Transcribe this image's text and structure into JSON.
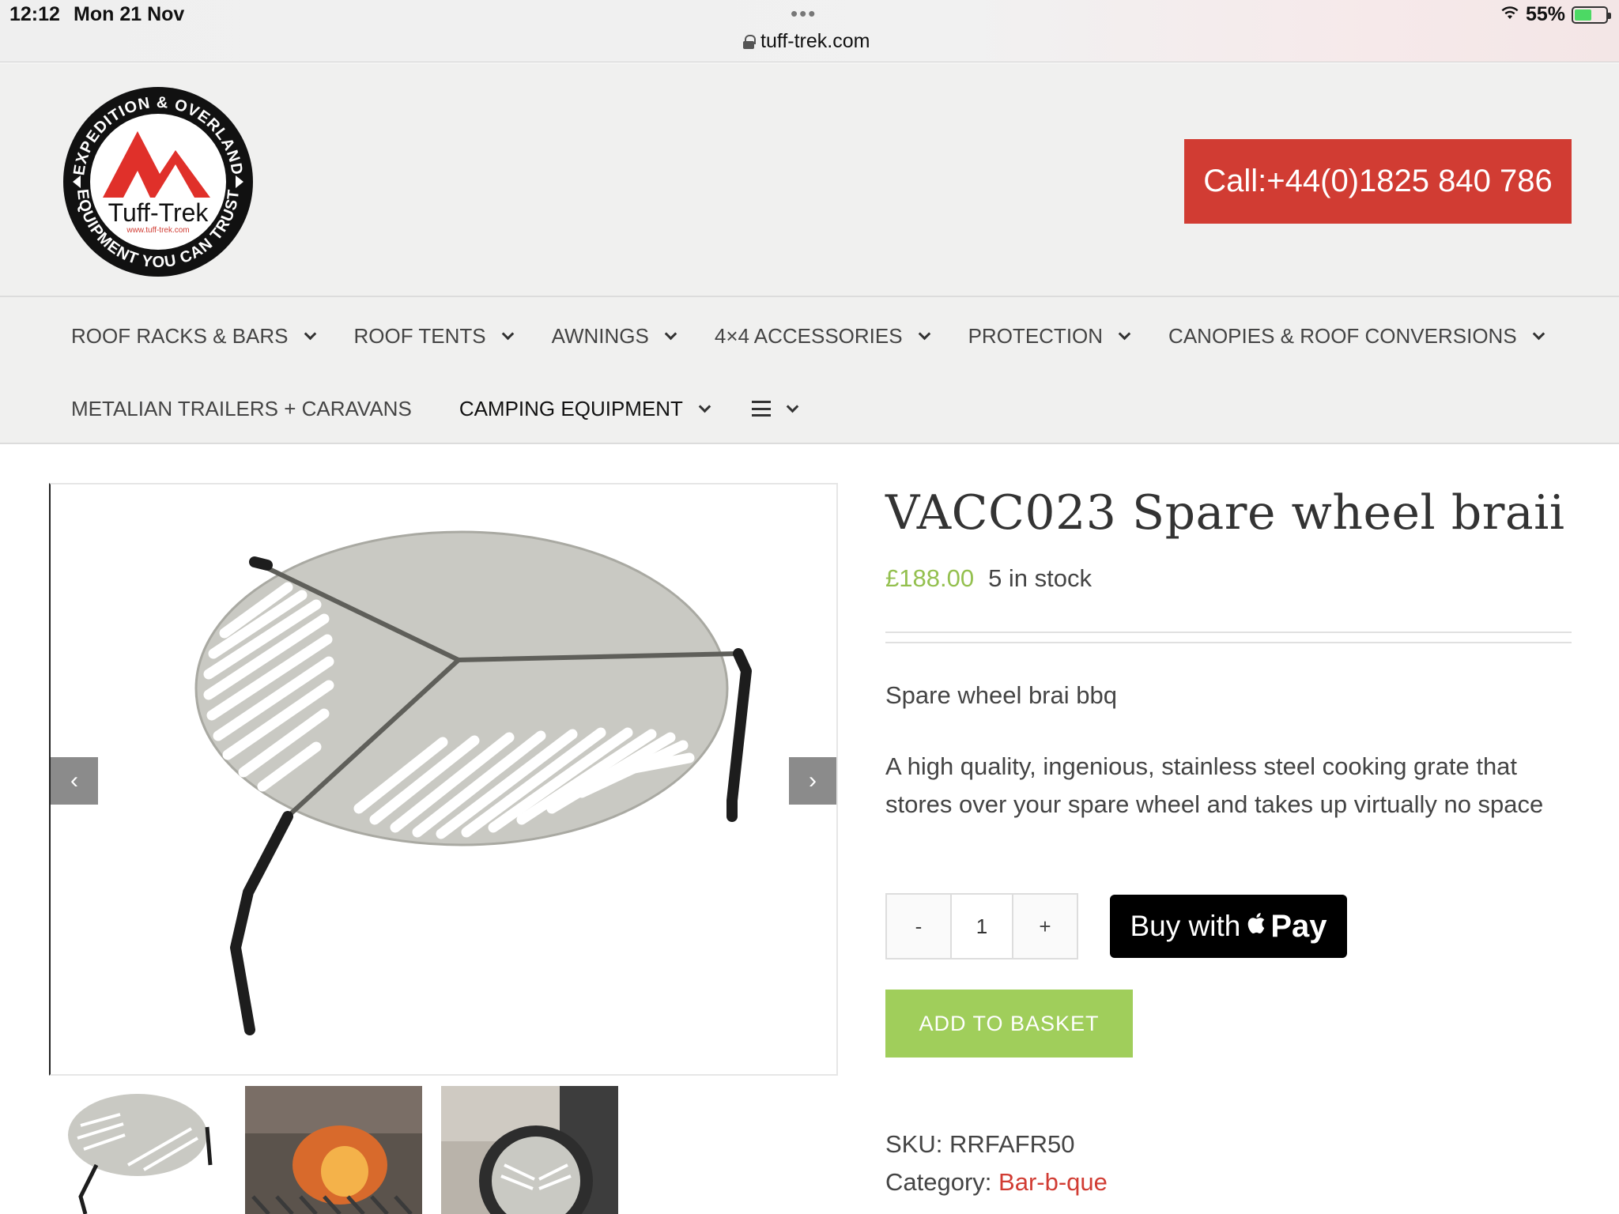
{
  "status_bar": {
    "time": "12:12",
    "date": "Mon 21 Nov",
    "url": "tuff-trek.com",
    "battery": "55%",
    "battery_level": 0.55
  },
  "header": {
    "logo_ring_top": "EXPEDITION & OVERLAND",
    "logo_ring_bottom": "EQUIPMENT YOU CAN TRUST",
    "logo_brand": "Tuff-Trek",
    "logo_url": "www.tuff-trek.com",
    "call_label": "Call:+44(0)1825 840 786",
    "brand_red": "#d13c33"
  },
  "nav": {
    "row1": [
      {
        "label": "ROOF RACKS & BARS"
      },
      {
        "label": "ROOF TENTS"
      },
      {
        "label": "AWNINGS"
      },
      {
        "label": "4×4 ACCESSORIES"
      },
      {
        "label": "PROTECTION"
      },
      {
        "label": "CANOPIES & ROOF CONVERSIONS"
      }
    ],
    "row2": [
      {
        "label": "METALIAN TRAILERS + CARAVANS"
      },
      {
        "label": "CAMPING EQUIPMENT"
      }
    ],
    "menu_icon": "hamburger-icon"
  },
  "gallery": {
    "prev_icon": "chevron-left-icon",
    "next_icon": "chevron-right-icon",
    "prev_glyph": "‹",
    "next_glyph": "›",
    "thumbnails": [
      "braai-grate",
      "braai-fire",
      "spare-wheel-mount"
    ]
  },
  "product": {
    "title": "VACC023 Spare wheel braii",
    "price": "£188.00",
    "stock": "5 in stock",
    "short_title": "Spare wheel brai bbq",
    "description": "A high quality, ingenious, stainless steel cooking grate that stores over your spare wheel and takes up virtually no space",
    "qty_minus": "-",
    "qty_value": "1",
    "qty_plus": "+",
    "apple_pay_prefix": "Buy with",
    "apple_pay_word": "Pay",
    "add_to_basket": "ADD TO BASKET",
    "sku_label": "SKU:",
    "sku_value": "RRFAFR50",
    "category_label": "Category:",
    "category_value": "Bar-b-que",
    "price_color": "#94c04f",
    "button_green": "#a0ce5b"
  }
}
